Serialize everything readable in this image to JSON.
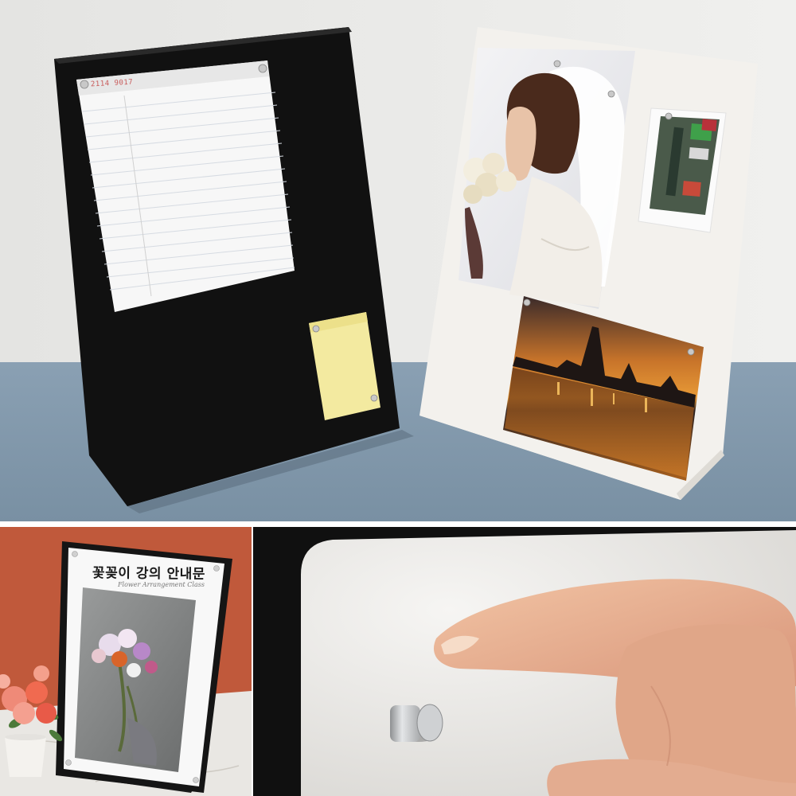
{
  "scene": {
    "description_free": true,
    "colors": {
      "wall": "#ebebea",
      "table": "#7d93a6",
      "black_board": "#111111",
      "white_board": "#f2f0ec",
      "sticky_note": "#f3eaa0",
      "terracotta_wall": "#c0593b",
      "marble": "#e8e6e2",
      "magnet": "#c4c6c8"
    }
  },
  "poster": {
    "title": "꽃꽂이 강의 안내문",
    "subtitle": "Flower Arrangement Class"
  },
  "notepad": {
    "header": "2114 9017"
  }
}
